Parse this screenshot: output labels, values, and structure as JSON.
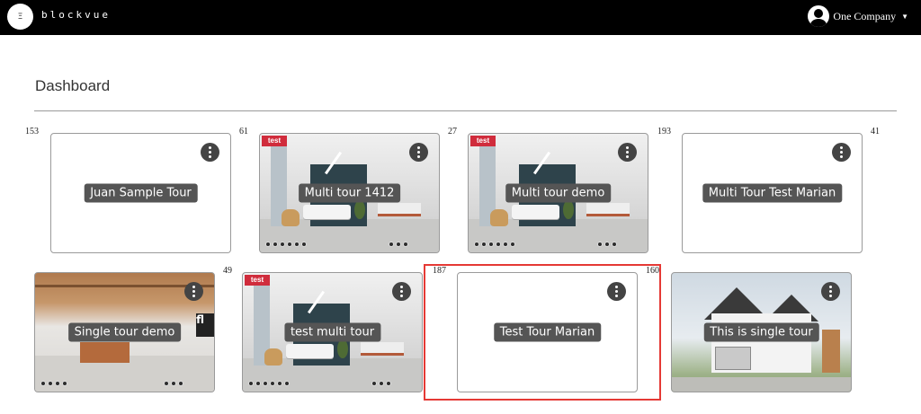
{
  "header": {
    "brand": "blockvue",
    "logo_text": "Ξ",
    "user_name": "One Company"
  },
  "page_title": "Dashboard",
  "tours": [
    {
      "name": "Juan Sample Tour",
      "count": "153",
      "thumb": "blank"
    },
    {
      "name": "Multi tour 1412",
      "count": "61",
      "thumb": "office"
    },
    {
      "name": "Multi tour demo",
      "count": "27",
      "thumb": "office"
    },
    {
      "name": "Multi Tour Test Marian",
      "count": "193",
      "thumb": "blank"
    },
    {
      "name": "Single tour demo",
      "count": "41",
      "thumb": "loft"
    },
    {
      "name": "test multi tour",
      "count": "49",
      "thumb": "office"
    },
    {
      "name": "Test Tour Marian",
      "count": "187",
      "thumb": "blank",
      "selected": true
    },
    {
      "name": "This is single tour",
      "count": "160",
      "thumb": "house"
    }
  ],
  "office_badge": "test",
  "loft_sign": "fl",
  "colors": {
    "navbar": "#000000",
    "label_bg": "#555555",
    "selection": "#e53935"
  }
}
